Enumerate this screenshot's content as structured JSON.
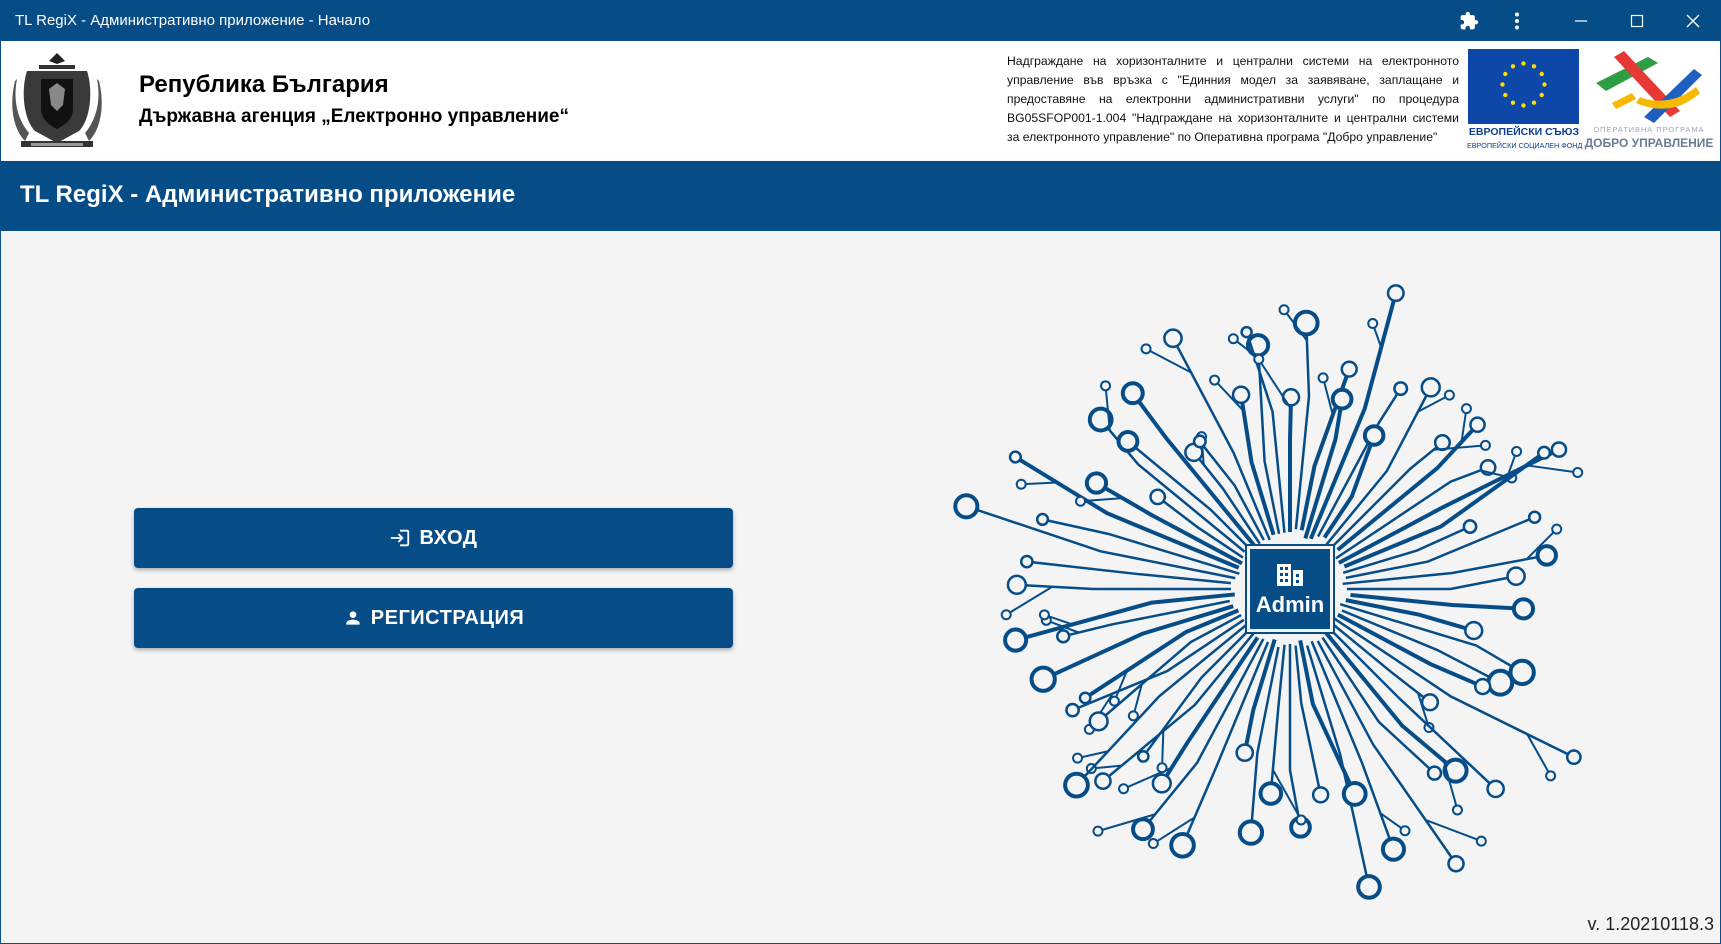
{
  "window": {
    "title": "TL RegiX - Административно приложение - Начало",
    "controls": [
      "extensions-icon",
      "more-icon",
      "minimize-icon",
      "maximize-icon",
      "close-icon"
    ]
  },
  "header": {
    "org_line1": "Република България",
    "org_line2": "Държавна агенция „Електронно управление“",
    "project_text": "Надграждане на хоризонталните и централни системи на електронното управление във връзка с \"Единния модел за заявяване, заплащане и предоставяне на електронни административни услуги\" по процедура BG05SFOP001-1.004 \"Надграждане на хоризонталните и централни системи за електронното управление\" по Оперативна програма \"Добро управление\"",
    "eu_logo_line1": "ЕВРОПЕЙСКИ СЪЮЗ",
    "eu_logo_line2": "ЕВРОПЕЙСКИ СОЦИАЛЕН ФОНД",
    "program_logo_line1": "ОПЕРАТИВНА ПРОГРАМА",
    "program_logo_line2": "ДОБРО УПРАВЛЕНИЕ"
  },
  "appbar": {
    "title": "TL RegiX - Административно приложение"
  },
  "main": {
    "login_label": "ВХОД",
    "register_label": "РЕГИСТРАЦИЯ",
    "chip_label": "Admin"
  },
  "footer": {
    "version": "v. 1.20210118.3"
  },
  "colors": {
    "primary": "#064d88",
    "background": "#f4f4f4"
  }
}
